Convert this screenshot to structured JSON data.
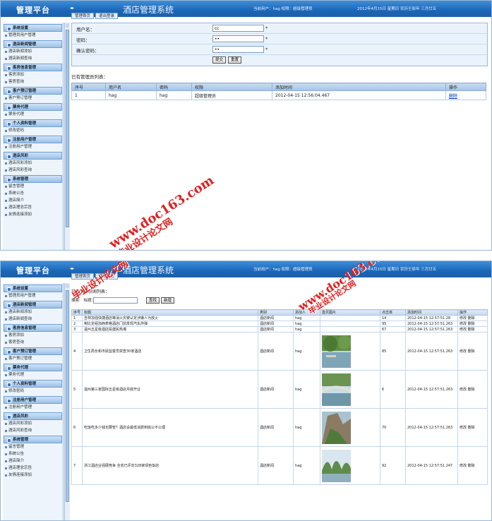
{
  "header": {
    "logo": "管理平台",
    "system_title": "酒店管理系统",
    "user_info": "当前用户：hag 权限：超级管理员",
    "date_info": "2012年4月15日 星期日 农历壬辰年 三月廿五",
    "tabs": [
      "管理首页",
      "退出登录"
    ]
  },
  "sidebar": [
    {
      "title": "系统设置",
      "items": [
        "管理员用户管理"
      ]
    },
    {
      "title": "酒店新闻管理",
      "items": [
        "酒店新闻添加",
        "酒店新闻查询"
      ]
    },
    {
      "title": "客房信息管理",
      "items": [
        "客房添加",
        "客房查询"
      ]
    },
    {
      "title": "客户预订管理",
      "items": [
        "客户预订管理"
      ]
    },
    {
      "title": "票务代理",
      "items": [
        "票务代理"
      ]
    },
    {
      "title": "个人资料管理",
      "items": [
        "修改密码"
      ]
    },
    {
      "title": "注册用户管理",
      "items": [
        "注册用户管理"
      ]
    },
    {
      "title": "酒店风彩",
      "items": [
        "酒店风彩添加",
        "酒店风彩查询"
      ]
    },
    {
      "title": "系统管理",
      "items": [
        "留言管理",
        "系统公告",
        "酒店简介",
        "酒店理念宗旨",
        "友情连接添加"
      ]
    }
  ],
  "admin_form": {
    "username_label": "用户名：",
    "username_value": "cc",
    "password_label": "密码：",
    "password_value": "••",
    "confirm_label": "确认密码：",
    "confirm_value": "••",
    "required_mark": "*",
    "submit_label": "提交",
    "reset_label": "重置",
    "list_title": "已有管理员列表："
  },
  "admin_table": {
    "headers": [
      "序号",
      "用户名",
      "密码",
      "权限",
      "添加时间",
      "操作"
    ],
    "rows": [
      [
        "1",
        "hag",
        "hag",
        "超级管理员",
        "2012-04-15 12:56:04.467",
        "删除"
      ]
    ]
  },
  "news_page": {
    "list_title": "已有酒店新闻列表：",
    "search_label": "搜索:",
    "search_field_label": "标题：",
    "search_button": "查找",
    "add_button": "新增",
    "headers": [
      "序号",
      "标题",
      "类别",
      "添加人",
      "首页图片",
      "点击率",
      "添加时间",
      "操作"
    ],
    "edit_label": "修改",
    "delete_label": "删除",
    "rows": [
      {
        "no": "1",
        "title": "吉林加强快捷酒店等消火灾被认定涉嫌人为放火",
        "category": "酒店新闻",
        "author": "hag",
        "hits": "14",
        "time": "2012-04-15 12:57:51.28",
        "img": ""
      },
      {
        "no": "2",
        "title": "荆比定组加西表格酒店门前发现汽车炸弹",
        "category": "酒店新闻",
        "author": "hag",
        "hits": "95",
        "time": "2012-04-15 12:57:51.263",
        "img": ""
      },
      {
        "no": "3",
        "title": "温州五星级酒店投建民热潮",
        "category": "酒店新闻",
        "author": "hag",
        "hits": "67",
        "time": "2012-04-15 12:57:51.263",
        "img": ""
      },
      {
        "no": "4",
        "title": "卫生局长和市民监督员突查30家酒店",
        "category": "酒店新闻",
        "author": "hag",
        "hits": "85",
        "time": "2012-04-15 12:57:51.263",
        "img": "pond"
      },
      {
        "no": "5",
        "title": "温州第三家国际五星级酒店月底开业",
        "category": "酒店新闻",
        "author": "hag",
        "hits": "6",
        "time": "2012-04-15 12:57:51.263",
        "img": "bridge"
      },
      {
        "no": "6",
        "title": "吃饭吃多少钱也要管？酒店设最低消费到底公不公理",
        "category": "酒店新闻",
        "author": "hag",
        "hits": "70",
        "time": "2012-04-15 12:57:51.263",
        "img": "cliff"
      },
      {
        "no": "7",
        "title": "浙江酒店业强硬竞争 全省已评定328家绿色饭店",
        "category": "酒店新闻",
        "author": "hag",
        "hits": "92",
        "time": "2012-04-15 12:57:51.247",
        "img": "karst"
      }
    ]
  },
  "watermarks": {
    "site": "www.doc163.com",
    "label": "毕业设计论文网"
  },
  "colors": {
    "header": "#1a66b8",
    "sidebar_bg": "#eef4fb",
    "table_head": "#a7c4e6",
    "link": "#0033cc",
    "watermark": "#e02020"
  }
}
